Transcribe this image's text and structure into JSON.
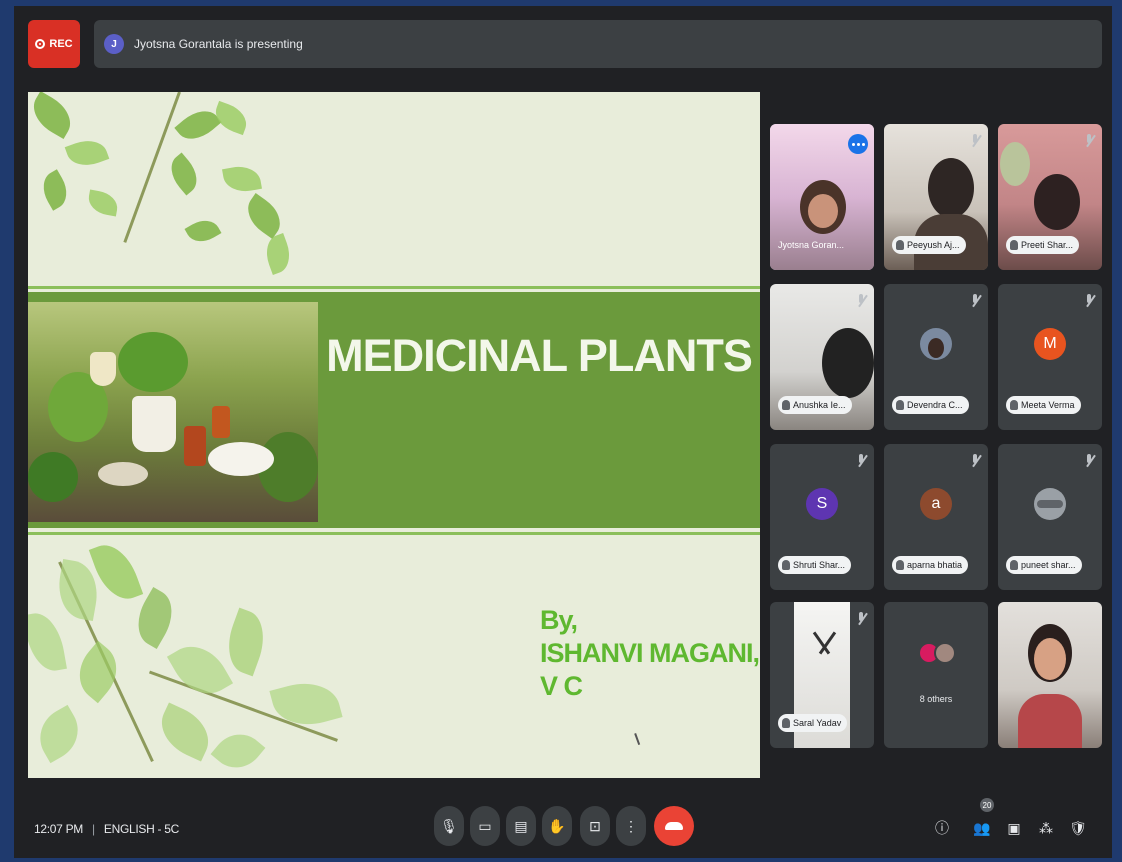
{
  "top_bar": {
    "rec_label": "REC",
    "presenter_initial": "J",
    "presenting_text": "Jyotsna Gorantala is presenting"
  },
  "slide": {
    "title": "MEDICINAL PLANTS",
    "by_line": "By,",
    "author_line": "ISHANVI MAGANI,",
    "class_line": "V C"
  },
  "participants": [
    {
      "name": "Jyotsna Goran...",
      "type": "video",
      "speaking": true
    },
    {
      "name": "Peeyush Aj...",
      "type": "video"
    },
    {
      "name": "Preeti Shar...",
      "type": "video"
    },
    {
      "name": "Anushka Ie...",
      "type": "video"
    },
    {
      "name": "Devendra C...",
      "type": "photo"
    },
    {
      "name": "Meeta Verma",
      "type": "letter",
      "letter": "M",
      "color": "#e8541f"
    },
    {
      "name": "Shruti Shar...",
      "type": "letter",
      "letter": "S",
      "color": "#5e35b1"
    },
    {
      "name": "aparna bhatia",
      "type": "letter",
      "letter": "a",
      "color": "#8d4a2e"
    },
    {
      "name": "puneet shar...",
      "type": "photo"
    },
    {
      "name": "Saral Yadav",
      "type": "video"
    },
    {
      "name": "8 others",
      "type": "others"
    },
    {
      "name": "",
      "type": "video"
    }
  ],
  "bottom_bar": {
    "time": "12:07 PM",
    "separator": "|",
    "meeting_code": "ENGLISH - 5C",
    "people_count": "20"
  },
  "colors": {
    "background": "#1f3a6e",
    "panel": "#202124",
    "tile": "#3c4043",
    "rec": "#d93025",
    "hangup": "#ea4335",
    "slide_band": "#6b9a3c",
    "author_text": "#5fb830"
  },
  "icons": {
    "mic": "mic-icon",
    "camera": "camera-icon",
    "captions": "captions-icon",
    "hand": "raise-hand-icon",
    "present": "present-icon",
    "more": "more-options-icon",
    "hangup": "hangup-icon",
    "info": "info-icon",
    "people": "people-icon",
    "chat": "chat-icon",
    "activities": "activities-icon",
    "host": "host-controls-icon"
  }
}
